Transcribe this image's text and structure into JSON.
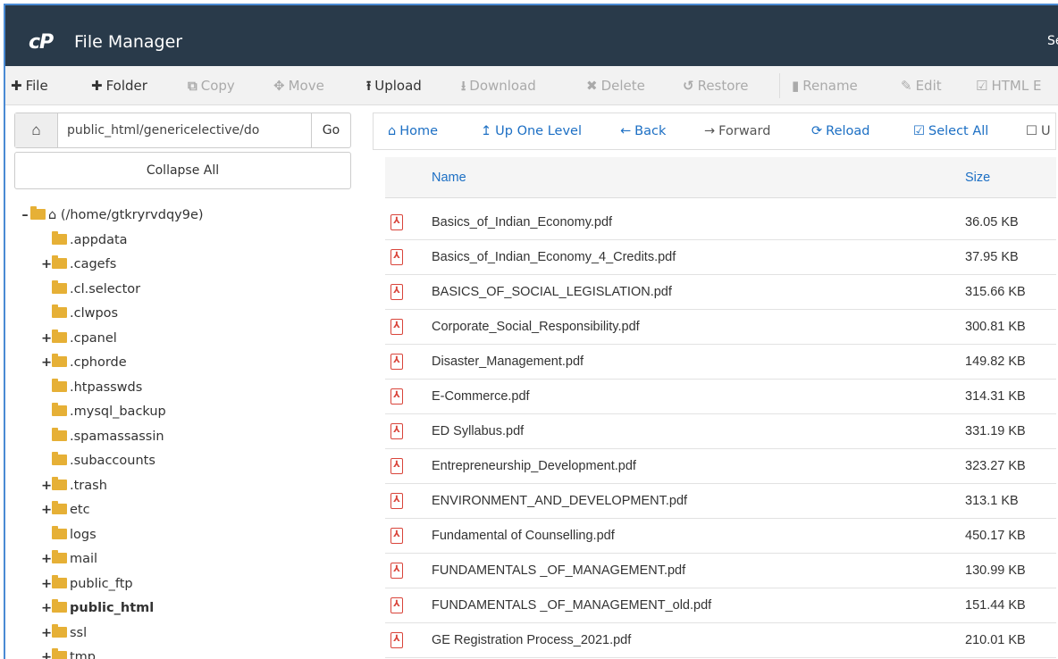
{
  "header": {
    "logo": "cP",
    "title": "File Manager",
    "right_text": "Se"
  },
  "toolbar": {
    "file": "File",
    "folder": "Folder",
    "copy": "Copy",
    "move": "Move",
    "upload": "Upload",
    "download": "Download",
    "delete": "Delete",
    "restore": "Restore",
    "rename": "Rename",
    "edit": "Edit",
    "html_editor": "HTML E"
  },
  "left": {
    "path_value": "public_html/genericelective/do",
    "go_label": "Go",
    "collapse_label": "Collapse All",
    "root_label": "(/home/gtkryrvdqy9e)",
    "tree": [
      {
        "label": ".appdata",
        "expandable": false
      },
      {
        "label": ".cagefs",
        "expandable": true
      },
      {
        "label": ".cl.selector",
        "expandable": false
      },
      {
        "label": ".clwpos",
        "expandable": false
      },
      {
        "label": ".cpanel",
        "expandable": true
      },
      {
        "label": ".cphorde",
        "expandable": true
      },
      {
        "label": ".htpasswds",
        "expandable": false
      },
      {
        "label": ".mysql_backup",
        "expandable": false
      },
      {
        "label": ".spamassassin",
        "expandable": false
      },
      {
        "label": ".subaccounts",
        "expandable": false
      },
      {
        "label": ".trash",
        "expandable": true
      },
      {
        "label": "etc",
        "expandable": true
      },
      {
        "label": "logs",
        "expandable": false
      },
      {
        "label": "mail",
        "expandable": true
      },
      {
        "label": "public_ftp",
        "expandable": true
      },
      {
        "label": "public_html",
        "expandable": true,
        "bold": true
      },
      {
        "label": "ssl",
        "expandable": true
      },
      {
        "label": "tmp",
        "expandable": true
      }
    ]
  },
  "navbar": {
    "home": "Home",
    "up": "Up One Level",
    "back": "Back",
    "forward": "Forward",
    "reload": "Reload",
    "select_all": "Select All",
    "unselect": "U"
  },
  "files": {
    "columns": {
      "name": "Name",
      "size": "Size"
    },
    "rows": [
      {
        "name": "Basics_of_Indian_Economy.pdf",
        "size": "36.05 KB"
      },
      {
        "name": "Basics_of_Indian_Economy_4_Credits.pdf",
        "size": "37.95 KB"
      },
      {
        "name": "BASICS_OF_SOCIAL_LEGISLATION.pdf",
        "size": "315.66 KB"
      },
      {
        "name": "Corporate_Social_Responsibility.pdf",
        "size": "300.81 KB"
      },
      {
        "name": "Disaster_Management.pdf",
        "size": "149.82 KB"
      },
      {
        "name": "E-Commerce.pdf",
        "size": "314.31 KB"
      },
      {
        "name": "ED Syllabus.pdf",
        "size": "331.19 KB"
      },
      {
        "name": "Entrepreneurship_Development.pdf",
        "size": "323.27 KB"
      },
      {
        "name": "ENVIRONMENT_AND_DEVELOPMENT.pdf",
        "size": "313.1 KB"
      },
      {
        "name": "Fundamental of Counselling.pdf",
        "size": "450.17 KB"
      },
      {
        "name": "FUNDAMENTALS _OF_MANAGEMENT.pdf",
        "size": "130.99 KB"
      },
      {
        "name": "FUNDAMENTALS _OF_MANAGEMENT_old.pdf",
        "size": "151.44 KB"
      },
      {
        "name": "GE Registration Process_2021.pdf",
        "size": "210.01 KB"
      }
    ]
  },
  "colors": {
    "header_bg": "#293a4a",
    "link_blue": "#1c6fc4",
    "folder": "#e6b036",
    "pdf_red": "#d9443a"
  }
}
